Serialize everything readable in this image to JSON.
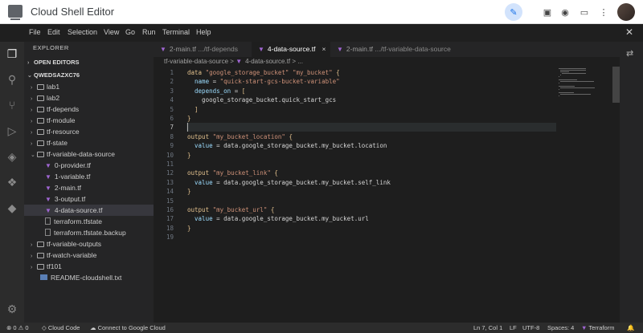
{
  "app": {
    "title": "Cloud Shell Editor"
  },
  "menu": [
    "File",
    "Edit",
    "Selection",
    "View",
    "Go",
    "Run",
    "Terminal",
    "Help"
  ],
  "sidebar": {
    "title": "EXPLORER",
    "open_editors": "OPEN EDITORS",
    "project": "QWEDSAZXC76",
    "items": [
      {
        "label": "lab1",
        "kind": "folder"
      },
      {
        "label": "lab2",
        "kind": "folder"
      },
      {
        "label": "tf-depends",
        "kind": "folder"
      },
      {
        "label": "tf-module",
        "kind": "folder"
      },
      {
        "label": "tf-resource",
        "kind": "folder"
      },
      {
        "label": "tf-state",
        "kind": "folder"
      },
      {
        "label": "tf-variable-data-source",
        "kind": "folder-open"
      },
      {
        "label": "0-provider.tf",
        "kind": "tf"
      },
      {
        "label": "1-variable.tf",
        "kind": "tf"
      },
      {
        "label": "2-main.tf",
        "kind": "tf"
      },
      {
        "label": "3-output.tf",
        "kind": "tf"
      },
      {
        "label": "4-data-source.tf",
        "kind": "tf",
        "selected": true
      },
      {
        "label": "terraform.tfstate",
        "kind": "file"
      },
      {
        "label": "terraform.tfstate.backup",
        "kind": "file"
      },
      {
        "label": "tf-variable-outputs",
        "kind": "folder"
      },
      {
        "label": "tf-watch-variable",
        "kind": "folder"
      },
      {
        "label": "tf101",
        "kind": "folder"
      },
      {
        "label": "README-cloudshell.txt",
        "kind": "md"
      }
    ]
  },
  "tabs": [
    {
      "name": "2-main.tf",
      "path": ".../tf-depends"
    },
    {
      "name": "4-data-source.tf",
      "path": "",
      "active": true,
      "close": "×"
    },
    {
      "name": "2-main.tf",
      "path": ".../tf-variable-data-source"
    }
  ],
  "breadcrumb": {
    "folder": "tf-variable-data-source",
    "sep": ">",
    "file": "4-data-source.tf",
    "more": "> ..."
  },
  "editor": {
    "current_line": 7,
    "lines": [
      "data \"google_storage_bucket\" \"my_bucket\" {",
      "  name = \"quick-start-gcs-bucket-variable\"",
      "  depends_on = [",
      "    google_storage_bucket.quick_start_gcs",
      "  ]",
      "}",
      "",
      "output \"my_bucket_location\" {",
      "  value = data.google_storage_bucket.my_bucket.location",
      "}",
      "",
      "output \"my_bucket_link\" {",
      "  value = data.google_storage_bucket.my_bucket.self_link",
      "}",
      "",
      "output \"my_bucket_url\" {",
      "  value = data.google_storage_bucket.my_bucket.url",
      "}",
      ""
    ]
  },
  "status": {
    "errors": "⊗ 0 ⚠ 0",
    "cloud_code": "◇ Cloud Code",
    "connect": "☁ Connect to Google Cloud",
    "position": "Ln 7, Col 1",
    "eol": "LF",
    "encoding": "UTF-8",
    "spaces": "Spaces: 4",
    "language": "Terraform",
    "bell": "🔔"
  },
  "colors": {
    "accent": "#1a73e8",
    "keyword": "#e2c08d",
    "string": "#ce9178",
    "tf_icon": "#a066d3"
  }
}
